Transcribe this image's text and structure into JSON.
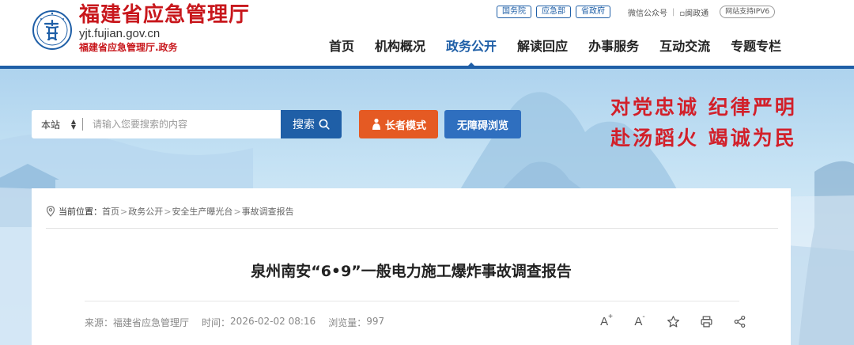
{
  "header": {
    "logo": {
      "title": "福建省应急管理厅",
      "domain": "yjt.fujian.gov.cn",
      "subtitle": "福建省应急管理厅.政务"
    },
    "top_links": {
      "tags": [
        "国务院",
        "应急部",
        "省政府"
      ],
      "wechat": "微信公众号",
      "mintong": "闽政通",
      "ipv6": "网站支持IPV6"
    },
    "nav": [
      {
        "label": "首页",
        "active": false
      },
      {
        "label": "机构概况",
        "active": false
      },
      {
        "label": "政务公开",
        "active": true
      },
      {
        "label": "解读回应",
        "active": false
      },
      {
        "label": "办事服务",
        "active": false
      },
      {
        "label": "互动交流",
        "active": false
      },
      {
        "label": "专题专栏",
        "active": false
      }
    ]
  },
  "banner": {
    "search": {
      "scope": "本站",
      "placeholder": "请输入您要搜索的内容",
      "button_label": "搜索"
    },
    "elder_mode_label": "长者模式",
    "accessibility_label": "无障碍浏览",
    "slogan_line1": "对党忠诚 纪律严明",
    "slogan_line2": "赴汤蹈火 竭诚为民"
  },
  "article": {
    "breadcrumb": {
      "label": "当前位置：",
      "items": [
        "首页",
        "政务公开",
        "安全生产曝光台",
        "事故调查报告"
      ],
      "separator": ">"
    },
    "title": "泉州南安“6•9”一般电力施工爆炸事故调查报告",
    "meta": {
      "source_label": "来源：",
      "source": "福建省应急管理厅",
      "time_label": "时间：",
      "time": "2026-02-02 08:16",
      "views_label": "浏览量：",
      "views": "997"
    },
    "tools": {
      "font_increase": "A",
      "font_increase_sign": "+",
      "font_decrease": "A",
      "font_decrease_sign": "-"
    }
  },
  "colors": {
    "brand_red": "#c8171c",
    "brand_blue": "#1f5fa7",
    "elder_orange": "#e55a23",
    "access_blue": "#2f6fbf",
    "slogan_red": "#d2202a"
  },
  "icons": [
    "emblem-icon",
    "search-icon",
    "person-icon",
    "location-pin-icon",
    "star-icon",
    "print-icon",
    "share-icon"
  ]
}
